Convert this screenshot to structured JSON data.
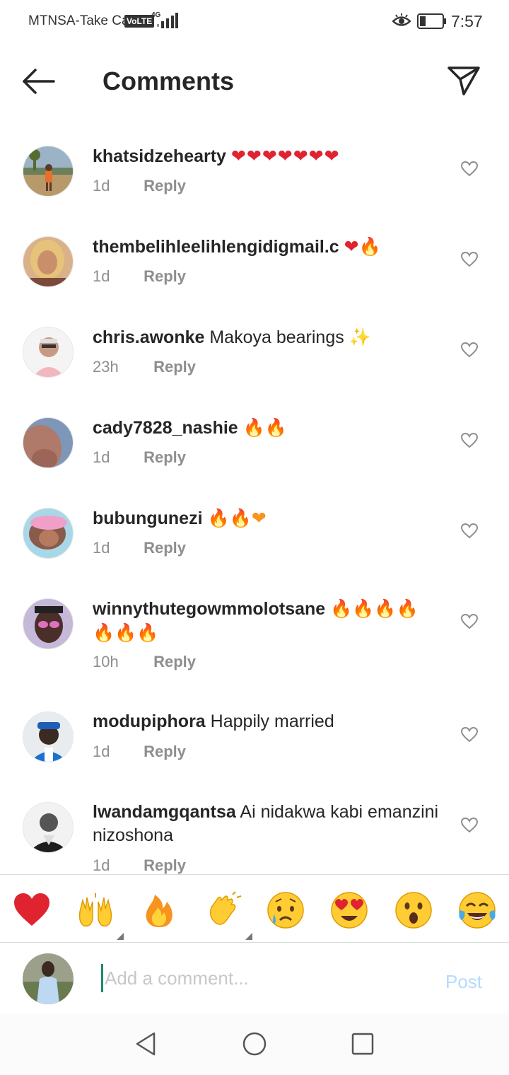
{
  "status_bar": {
    "carrier": "MTNSA-Take Ca",
    "volte": "VoLTE",
    "network": "4G",
    "time": "7:57"
  },
  "header": {
    "title": "Comments",
    "back_icon": "back-arrow-icon",
    "send_icon": "paper-plane-icon"
  },
  "comments": [
    {
      "username": "khatsidzehearty",
      "text": "",
      "emojis": "❤❤❤❤❤❤❤",
      "time": "1d",
      "reply": "Reply"
    },
    {
      "username": "thembelihleelihlengidigmail.c",
      "text": "",
      "emojis": "❤🔥",
      "time": "1d",
      "reply": "Reply"
    },
    {
      "username": "chris.awonke",
      "text": "Makoya bearings",
      "emojis": "✨",
      "time": "23h",
      "reply": "Reply"
    },
    {
      "username": "cady7828_nashie",
      "text": "",
      "emojis": "🔥🔥",
      "time": "1d",
      "reply": "Reply"
    },
    {
      "username": "bubungunezi",
      "text": "",
      "emojis": "🔥🔥❤",
      "time": "1d",
      "reply": "Reply"
    },
    {
      "username": "winnythutegowmmolotsane",
      "text": "",
      "emojis": "🔥🔥🔥🔥 🔥🔥🔥",
      "time": "10h",
      "reply": "Reply"
    },
    {
      "username": "modupiphora",
      "text": "Happily married",
      "emojis": "",
      "time": "1d",
      "reply": "Reply"
    },
    {
      "username": "lwandamgqantsa",
      "text": "Ai nidakwa kabi emanzini nizoshona",
      "emojis": "",
      "time": "1d",
      "reply": "Reply"
    }
  ],
  "emoji_bar": [
    "heart",
    "raising-hands",
    "fire",
    "clapping-hands",
    "sad-tear",
    "heart-eyes",
    "surprised",
    "tears-of-joy"
  ],
  "input": {
    "placeholder": "Add a comment...",
    "post_label": "Post"
  },
  "colors": {
    "text": "#262626",
    "muted": "#8e8e8e",
    "post_disabled": "#b3dbff",
    "heart_red": "#e0242f",
    "fire_orange": "#f7931e"
  }
}
